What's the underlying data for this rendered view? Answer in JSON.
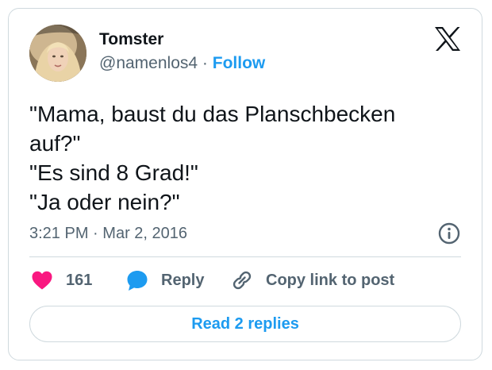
{
  "author": {
    "display_name": "Tomster",
    "handle": "@namenlos4",
    "separator": "·",
    "follow_label": "Follow",
    "avatar_icon": "user-avatar-photo"
  },
  "brand": {
    "logo_icon": "x-logo-icon"
  },
  "tweet": {
    "lines": [
      "\"Mama, baust du das Planschbecken",
      "auf?\"",
      "\"Es sind 8 Grad!\"",
      "\"Ja oder nein?\""
    ],
    "time": "3:21 PM",
    "separator": "·",
    "date": "Mar 2, 2016"
  },
  "actions": {
    "like_count": "161",
    "reply_label": "Reply",
    "copy_label": "Copy link to post",
    "read_replies_label": "Read 2 replies"
  },
  "icons": {
    "info": "info-icon",
    "heart": "heart-icon",
    "reply": "reply-bubble-icon",
    "link": "link-icon"
  },
  "colors": {
    "accent": "#1d9bf0",
    "like": "#f91880",
    "text": "#0f1419",
    "muted": "#536471",
    "border": "#cfd9de"
  }
}
